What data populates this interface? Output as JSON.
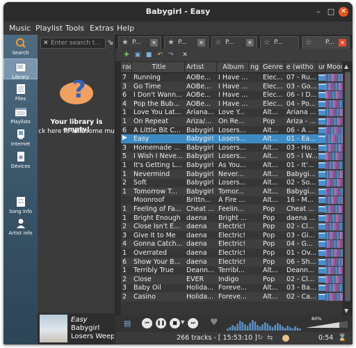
{
  "window": {
    "title": "Babygirl - Easy"
  },
  "menu": [
    "Music",
    "Playlist",
    "Tools",
    "Extras",
    "Help"
  ],
  "sidebar": [
    {
      "label": "Search",
      "icon": "search-icon"
    },
    {
      "label": "Library",
      "icon": "library-icon",
      "selected": true
    },
    {
      "label": "Files",
      "icon": "files-icon"
    },
    {
      "label": "Playlists",
      "icon": "playlists-icon"
    },
    {
      "label": "Internet",
      "icon": "internet-icon"
    },
    {
      "label": "Devices",
      "icon": "devices-icon"
    },
    {
      "label": "Song info",
      "icon": "song-info-icon"
    },
    {
      "label": "Artist info",
      "icon": "artist-info-icon"
    }
  ],
  "library": {
    "search_placeholder": "Enter search t...",
    "empty_title": "Your library is empty!",
    "empty_hint": "ck here to add some mu"
  },
  "now_playing": {
    "title": "Easy",
    "artist": "Babygirl",
    "album": "Losers Weepe"
  },
  "tabs": [
    {
      "label": "P..."
    },
    {
      "label": "P..."
    },
    {
      "label": "P..."
    },
    {
      "label": "P..."
    }
  ],
  "columns": [
    "rac",
    "Title",
    "Artist",
    "Album",
    "ng",
    "Genre",
    "e (witho",
    "ur",
    "Mood"
  ],
  "tracks": [
    {
      "n": "7",
      "title": "Running",
      "artist": "AOBe...",
      "album": "I Have ...",
      "genre": "Elec...",
      "file": "07 - Ru..."
    },
    {
      "n": "3",
      "title": "Go Time",
      "artist": "AOBe...",
      "album": "I Have ...",
      "genre": "Elec...",
      "file": "03 - Go..."
    },
    {
      "n": "6",
      "title": "I Don't Wann...",
      "artist": "AOBe...",
      "album": "I Have ...",
      "genre": "Elec...",
      "file": "06 - I D..."
    },
    {
      "n": "4",
      "title": "Pop the Bub...",
      "artist": "AOBe...",
      "album": "I Have ...",
      "genre": "Elec...",
      "file": "04 - Po..."
    },
    {
      "n": "1",
      "title": "Love You Lat...",
      "artist": "Ariana...",
      "album": "Love Y...",
      "genre": "Alt...",
      "file": "Ariana ..."
    },
    {
      "n": "1",
      "title": "On Repeat",
      "artist": "Ariza/...",
      "album": "On Re...",
      "genre": "Pop",
      "file": "Ariza - ..."
    },
    {
      "n": "6",
      "title": "A Little Bit C...",
      "artist": "Babygirl",
      "album": "Losers...",
      "genre": "Alt...",
      "file": "06 - A ..."
    },
    {
      "n": "",
      "title": "Easy",
      "artist": "Babygirl",
      "album": "Losers...",
      "genre": "Alt...",
      "file": "01 - Ea...",
      "playing": true
    },
    {
      "n": "3",
      "title": "Homemade ...",
      "artist": "Babygirl",
      "album": "Losers...",
      "genre": "Alt...",
      "file": "03 - Ho..."
    },
    {
      "n": "5",
      "title": "I Wish I Neve...",
      "artist": "Babygirl",
      "album": "Losers...",
      "genre": "Alt...",
      "file": "05 - I W..."
    },
    {
      "n": "1",
      "title": "It's Getting L...",
      "artist": "Babygirl",
      "album": "As You...",
      "genre": "Alt...",
      "file": "01 - It'..."
    },
    {
      "n": "1",
      "title": "Nevermind",
      "artist": "Babygirl",
      "album": "Never...",
      "genre": "Alt...",
      "file": "Babygi..."
    },
    {
      "n": "2",
      "title": "Soft",
      "artist": "Babygirl",
      "album": "Losers...",
      "genre": "Alt...",
      "file": "02 - So..."
    },
    {
      "n": "1",
      "title": "Tomorrow T...",
      "artist": "Babygirl",
      "album": "Tomor...",
      "genre": "Alt...",
      "file": "Babygi..."
    },
    {
      "n": "",
      "title": "Moonroof",
      "artist": "Brittn...",
      "album": "A Fire ...",
      "genre": "Alt...",
      "file": "16 - M..."
    },
    {
      "n": "1",
      "title": "Feeling of Fa...",
      "artist": "Cheat ...",
      "album": "Feelin...",
      "genre": "Pop",
      "file": "Cheat ..."
    },
    {
      "n": "1",
      "title": "Bright Enough",
      "artist": "daena",
      "album": "Bright ...",
      "genre": "Pop",
      "file": "daena ..."
    },
    {
      "n": "2",
      "title": "Close Isn't E...",
      "artist": "daena",
      "album": "Electric!",
      "genre": "Pop",
      "file": "02 - Cl..."
    },
    {
      "n": "3",
      "title": "Give It to Me",
      "artist": "daena",
      "album": "Electric!",
      "genre": "Pop",
      "file": "03 - Gi..."
    },
    {
      "n": "4",
      "title": "Gonna Catch...",
      "artist": "daena",
      "album": "Electric!",
      "genre": "Pop",
      "file": "04 - G..."
    },
    {
      "n": "1",
      "title": "Overrated",
      "artist": "daena",
      "album": "Electric!",
      "genre": "Pop",
      "file": "01 - Ov..."
    },
    {
      "n": "6",
      "title": "Show Your B...",
      "artist": "daena",
      "album": "Electric!",
      "genre": "Pop",
      "file": "06 - Sh..."
    },
    {
      "n": "1",
      "title": "Terribly True",
      "artist": "Deann...",
      "album": "Terribl...",
      "genre": "Alt...",
      "file": "Deann..."
    },
    {
      "n": "2",
      "title": "Close",
      "artist": "EVER",
      "album": "Indigo",
      "genre": "Pop",
      "file": "02 - Cl..."
    },
    {
      "n": "3",
      "title": "Baby Oil",
      "artist": "Holida...",
      "album": "Foreve...",
      "genre": "Alt...",
      "file": "03 - Ba..."
    },
    {
      "n": "2",
      "title": "Casino",
      "artist": "Holida...",
      "album": "Foreve...",
      "genre": "Alt...",
      "file": "02 - Ca..."
    }
  ],
  "controls": {
    "volume_label": "80%",
    "volume": 0.8
  },
  "status": {
    "tracks": "266 tracks - [ 15:53:10 ]",
    "elapsed": "0:54"
  },
  "colors": {
    "accent": "#3d8bc4",
    "close": "#e95420"
  }
}
